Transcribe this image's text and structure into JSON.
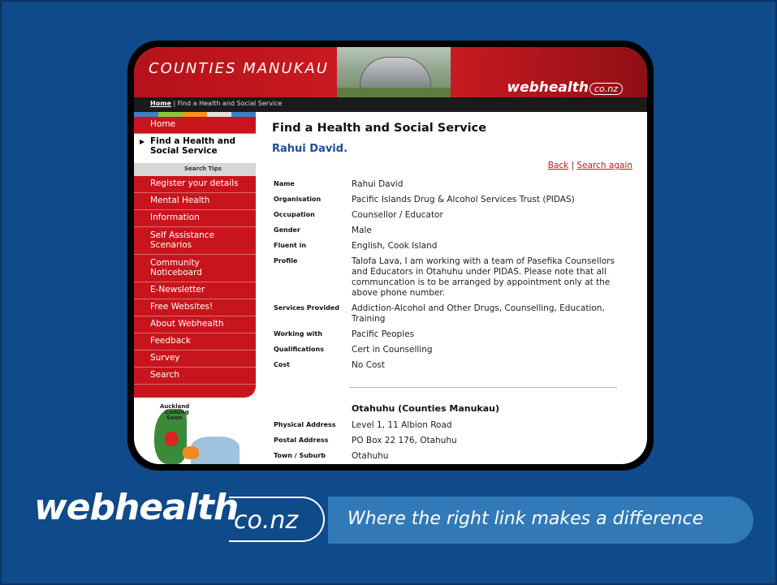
{
  "header": {
    "title": "COUNTIES MANUKAU",
    "logo": "webhealth",
    "logo_tld": "co.nz",
    "crumb_home": "Home",
    "crumb_current": "Find a Health and Social Service"
  },
  "stripe_colors": [
    "#3f7fc4",
    "#8cc63f",
    "#f7941d",
    "#e0e0e0",
    "#3f7fc4"
  ],
  "sidebar": {
    "home": "Home",
    "active_line1": "Find a Health and",
    "active_line2": "Social Service",
    "sub": "Search Tips",
    "items": [
      "Register your details",
      "Mental Health",
      "Information",
      "Self Assistance",
      "Scenarios",
      "Community",
      "Noticeboard",
      "E-Newsletter",
      "Free Websites!",
      "About Webhealth",
      "Feedback",
      "Survey",
      "Search"
    ],
    "map_label1": "Auckland",
    "map_label2": "Coming",
    "map_label3": "Soon"
  },
  "main": {
    "heading": "Find a Health and Social Service",
    "person": "Rahui David.",
    "back": "Back",
    "separator": "|",
    "search_again": "Search again",
    "fields": [
      {
        "label": "Name",
        "value": "Rahui David"
      },
      {
        "label": "Organisation",
        "value": "Pacific Islands Drug & Alcohol Services Trust (PIDAS)"
      },
      {
        "label": "Occupation",
        "value": "Counsellor / Educator"
      },
      {
        "label": "Gender",
        "value": "Male"
      },
      {
        "label": "Fluent in",
        "value": "English, Cook Island"
      },
      {
        "label": "Profile",
        "value": "Talofa Lava, I am working with a team of Pasefika Counsellors and Educators in Otahuhu under PIDAS. Please note that all communcation is to be arranged by appointment only at the above phone number."
      },
      {
        "label": "Services Provided",
        "value": "Addiction-Alcohol and Other Drugs, Counselling, Education, Training"
      },
      {
        "label": "Working with",
        "value": "Pacific Peoples"
      },
      {
        "label": "Qualifications",
        "value": "Cert in Counselling"
      },
      {
        "label": "Cost",
        "value": "No Cost"
      }
    ],
    "location_heading": "Otahuhu (Counties Manukau)",
    "address": [
      {
        "label": "Physical Address",
        "value": "Level 1, 11 Albion Road"
      },
      {
        "label": "Postal Address",
        "value": "PO Box 22 176, Otahuhu"
      },
      {
        "label": "Town / Suburb",
        "value": "Otahuhu"
      }
    ]
  },
  "branding": {
    "name": "webhealth",
    "tld": "co.nz",
    "tagline": "Where the right link makes a difference"
  }
}
